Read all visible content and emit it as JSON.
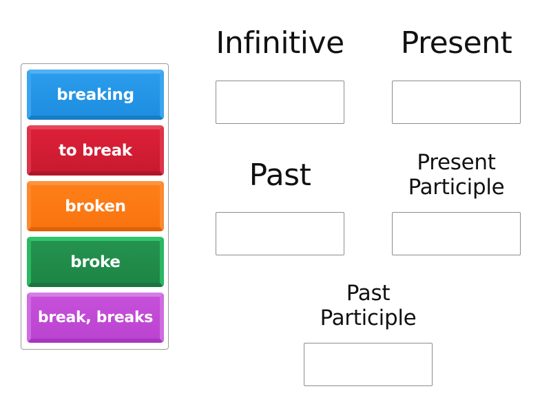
{
  "tray": {
    "tiles": [
      {
        "label": "breaking",
        "color": "#2196e8"
      },
      {
        "label": "to break",
        "color": "#d91f35"
      },
      {
        "label": "broken",
        "color": "#fd7a14"
      },
      {
        "label": "broke",
        "color": "#21904c"
      },
      {
        "label": "break, breaks",
        "color": "#c24fd6"
      }
    ]
  },
  "targets": [
    {
      "heading": "Infinitive",
      "value": ""
    },
    {
      "heading": "Present",
      "value": ""
    },
    {
      "heading": "Past",
      "value": ""
    },
    {
      "heading_lines": [
        "Present",
        "Participle"
      ],
      "value": ""
    },
    {
      "heading_lines": [
        "Past",
        "Participle"
      ],
      "value": ""
    }
  ]
}
